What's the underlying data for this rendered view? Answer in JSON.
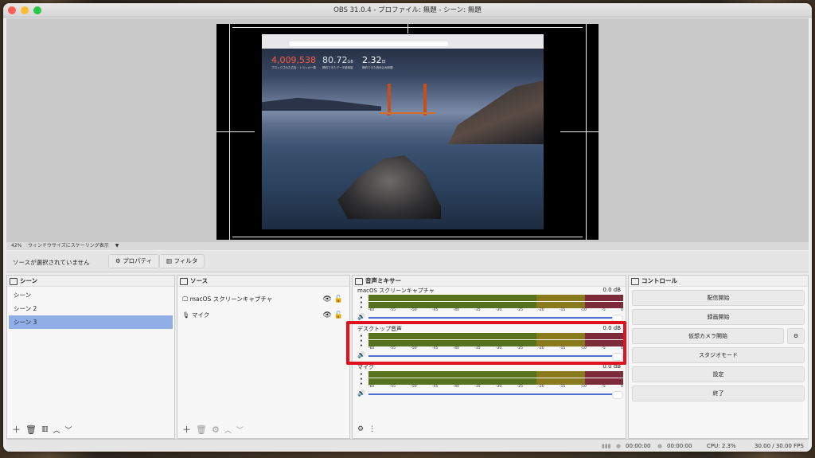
{
  "window": {
    "title": "OBS 31.0.4 - プロファイル: 無題 - シーン: 無題"
  },
  "preview": {
    "zoom": "42%",
    "scale_mode": "ウィンドウサイズにスケーリング表示",
    "stats": [
      {
        "value": "4,009,538",
        "label": "ブロックされた広告・トラッカー数",
        "color": "#ff5a45"
      },
      {
        "value": "80.72",
        "unit": "GB",
        "label": "節約できたデータ使用量",
        "color": "#dfe3ea"
      },
      {
        "value": "2.32",
        "unit": "日",
        "label": "節約できた読み込み時間",
        "color": "#ffffff"
      }
    ]
  },
  "sourcebar": {
    "no_source": "ソースが選択されていません",
    "properties": "プロパティ",
    "filters": "フィルタ"
  },
  "scenes": {
    "title": "シーン",
    "items": [
      {
        "label": "シーン",
        "selected": false
      },
      {
        "label": "シーン 2",
        "selected": false
      },
      {
        "label": "シーン 3",
        "selected": true
      }
    ]
  },
  "sources": {
    "title": "ソース",
    "items": [
      {
        "label": "macOS スクリーンキャプチャ",
        "icon": "monitor-icon"
      },
      {
        "label": "マイク",
        "icon": "microphone-icon"
      }
    ]
  },
  "mixer": {
    "title": "音声ミキサー",
    "ticks": [
      "-60",
      "-55",
      "-50",
      "-45",
      "-40",
      "-35",
      "-30",
      "-25",
      "-20",
      "-15",
      "-10",
      "-5",
      "0"
    ],
    "channels": [
      {
        "name": "macOS スクリーンキャプチャ",
        "db": "0.0 dB"
      },
      {
        "name": "デスクトップ音声",
        "db": "0.0 dB"
      },
      {
        "name": "マイク",
        "db": "0.0 dB"
      }
    ]
  },
  "controls": {
    "title": "コントロール",
    "buttons": [
      "配信開始",
      "録画開始",
      "仮想カメラ開始",
      "スタジオモード",
      "設定",
      "終了"
    ]
  },
  "statusbar": {
    "stream_time": "00:00:00",
    "rec_time": "00:00:00",
    "cpu": "CPU: 2.3%",
    "fps": "30.00 / 30.00 FPS"
  }
}
